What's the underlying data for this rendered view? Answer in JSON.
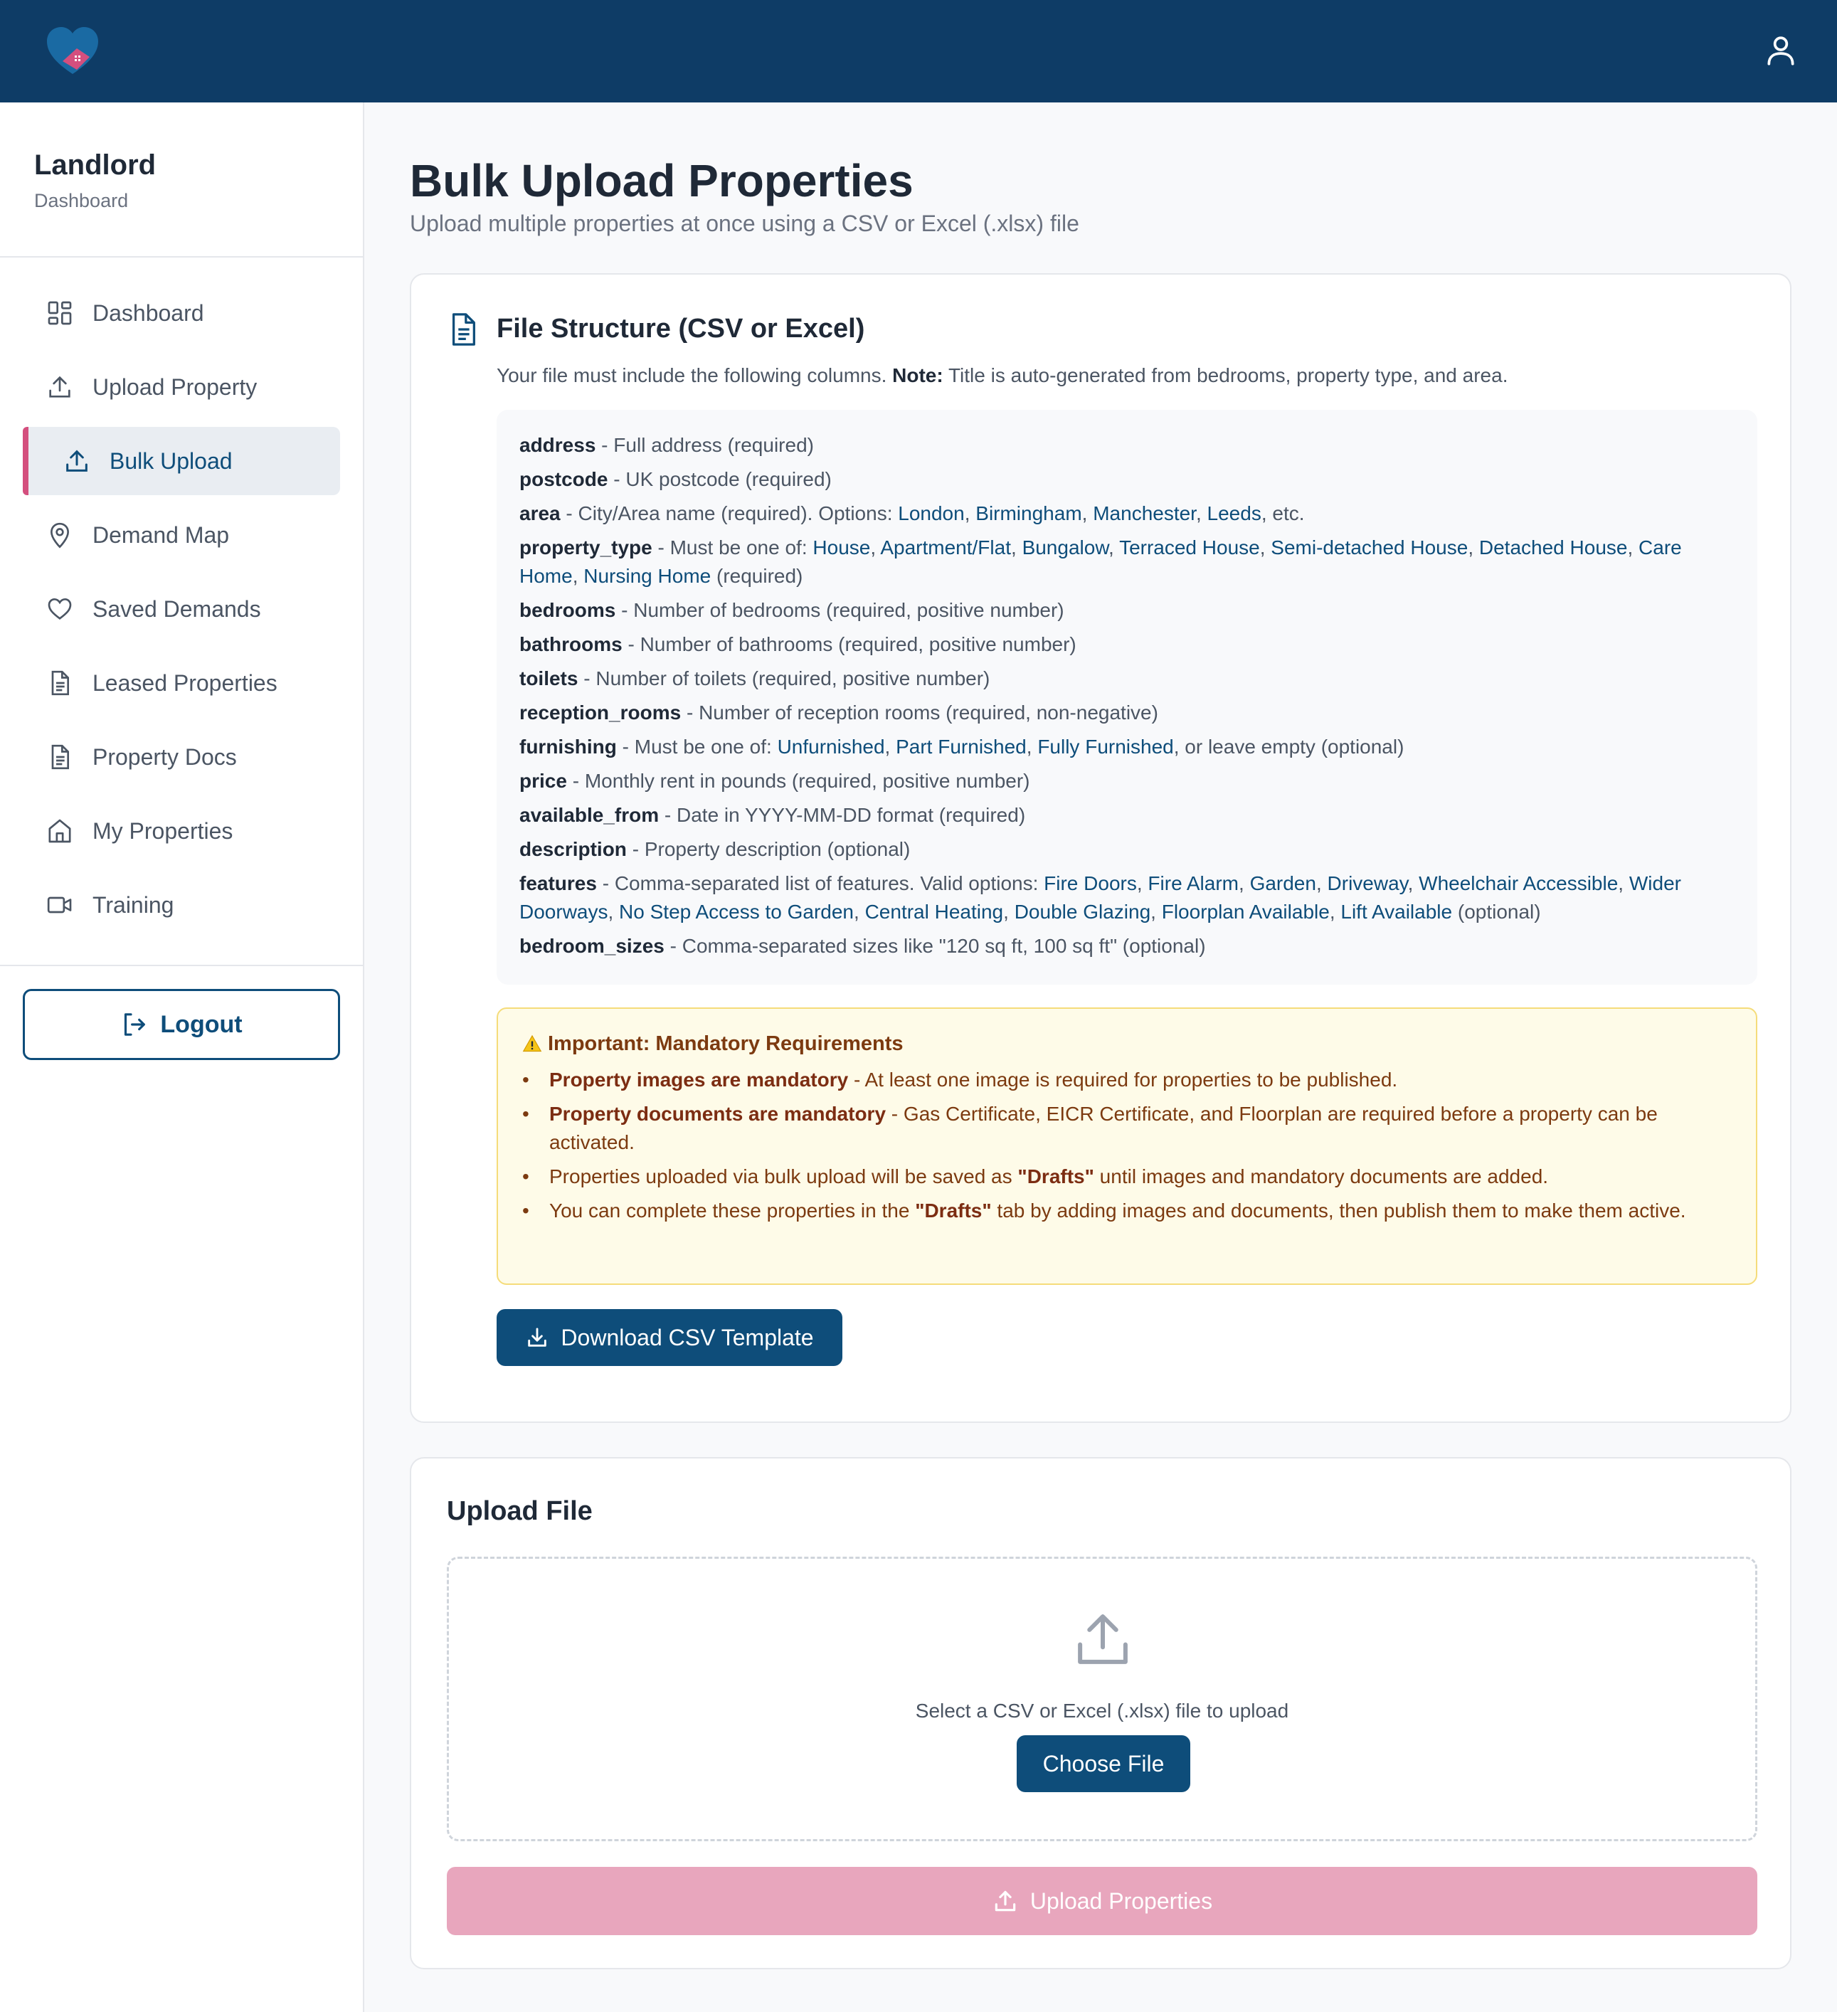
{
  "header": {
    "logo_icon": "heart-house-logo",
    "user_icon": "user-icon",
    "colors": {
      "navy": "#0e3c66",
      "pink": "#d44f7e"
    }
  },
  "sidebar": {
    "brand_title": "Landlord",
    "brand_sub": "Dashboard",
    "items": [
      {
        "label": "Dashboard",
        "icon": "dashboard-grid-icon"
      },
      {
        "label": "Upload Property",
        "icon": "upload-icon"
      },
      {
        "label": "Bulk Upload",
        "icon": "upload-icon",
        "active": true
      },
      {
        "label": "Demand Map",
        "icon": "map-pin-icon"
      },
      {
        "label": "Saved Demands",
        "icon": "heart-icon"
      },
      {
        "label": "Leased Properties",
        "icon": "document-icon"
      },
      {
        "label": "Property Docs",
        "icon": "document-icon"
      },
      {
        "label": "My Properties",
        "icon": "home-icon"
      },
      {
        "label": "Training",
        "icon": "video-icon"
      }
    ],
    "logout_label": "Logout"
  },
  "page": {
    "title": "Bulk Upload Properties",
    "subtitle": "Upload multiple properties at once using a CSV or Excel (.xlsx) file"
  },
  "file_structure": {
    "title": "File Structure (CSV or Excel)",
    "desc_prefix": "Your file must include the following columns.",
    "desc_note_label": "Note:",
    "desc_note": "Title is auto-generated from bedrooms, property type, and area.",
    "columns": [
      {
        "name": "address",
        "desc": "Full address (required)"
      },
      {
        "name": "postcode",
        "desc": "UK postcode (required)"
      },
      {
        "name": "area",
        "desc": "City/Area name (required). Options:",
        "options": [
          "London",
          "Birmingham",
          "Manchester",
          "Leeds"
        ],
        "suffix": ", etc."
      },
      {
        "name": "property_type",
        "desc": "Must be one of:",
        "options": [
          "House",
          "Apartment/Flat",
          "Bungalow",
          "Terraced House",
          "Semi-detached House",
          "Detached House",
          "Care Home",
          "Nursing Home"
        ],
        "suffix": " (required)"
      },
      {
        "name": "bedrooms",
        "desc": "Number of bedrooms (required, positive number)"
      },
      {
        "name": "bathrooms",
        "desc": "Number of bathrooms (required, positive number)"
      },
      {
        "name": "toilets",
        "desc": "Number of toilets (required, positive number)"
      },
      {
        "name": "reception_rooms",
        "desc": "Number of reception rooms (required, non-negative)"
      },
      {
        "name": "furnishing",
        "desc": "Must be one of:",
        "options": [
          "Unfurnished",
          "Part Furnished",
          "Fully Furnished"
        ],
        "suffix": ", or leave empty (optional)"
      },
      {
        "name": "price",
        "desc": "Monthly rent in pounds (required, positive number)"
      },
      {
        "name": "available_from",
        "desc": "Date in YYYY-MM-DD format (required)"
      },
      {
        "name": "description",
        "desc": "Property description (optional)"
      },
      {
        "name": "features",
        "desc": "Comma-separated list of features. Valid options:",
        "options": [
          "Fire Doors",
          "Fire Alarm",
          "Garden",
          "Driveway",
          "Wheelchair Accessible",
          "Wider Doorways",
          "No Step Access to Garden",
          "Central Heating",
          "Double Glazing",
          "Floorplan Available",
          "Lift Available"
        ],
        "suffix": " (optional)"
      },
      {
        "name": "bedroom_sizes",
        "desc": "Comma-separated sizes like \"120 sq ft, 100 sq ft\" (optional)"
      }
    ]
  },
  "warning": {
    "title": "Important: Mandatory Requirements",
    "items": [
      {
        "bold": "Property images are mandatory",
        "text": " - At least one image is required for properties to be published."
      },
      {
        "bold": "Property documents are mandatory",
        "text": " - Gas Certificate, EICR Certificate, and Floorplan are required before a property can be activated."
      },
      {
        "pre": "Properties uploaded via bulk upload will be saved as ",
        "bold": "\"Drafts\"",
        "text": " until images and mandatory documents are added."
      },
      {
        "pre": "You can complete these properties in the ",
        "bold": "\"Drafts\"",
        "text": " tab by adding images and documents, then publish them to make them active."
      }
    ]
  },
  "download_label": "Download CSV Template",
  "upload_file": {
    "title": "Upload File",
    "drop_text": "Select a CSV or Excel (.xlsx) file to upload",
    "choose_label": "Choose File",
    "upload_label": "Upload Properties"
  }
}
